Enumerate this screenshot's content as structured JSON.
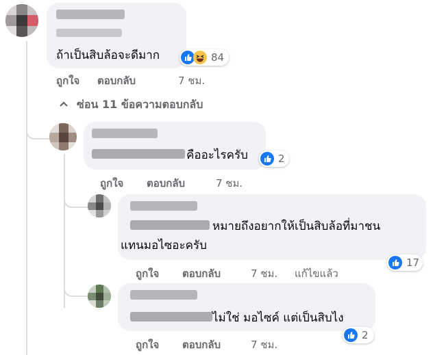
{
  "colors": {
    "bubble": "#f0f2f5",
    "meta_text": "#65676b",
    "like_blue": "#1877f2",
    "haha_yellow": "#f7c44b",
    "thread_line": "#dadde1"
  },
  "icons": {
    "like": "like-icon",
    "haha": "haha-icon",
    "chevron": "chevron-up-icon"
  },
  "comments": [
    {
      "text": "ถ้าเป็นสิบล้อจะดีมาก",
      "reactions": [
        "like",
        "haha"
      ],
      "reaction_count": "84",
      "like_label": "ถูกใจ",
      "reply_label": "ตอบกลับ",
      "time": "7 ชม."
    }
  ],
  "hide_replies_label": "ซ่อน 11 ข้อความตอบกลับ",
  "replies": [
    {
      "text": "คืออะไรครับ",
      "reactions": [
        "like"
      ],
      "reaction_count": "2",
      "like_label": "ถูกใจ",
      "reply_label": "ตอบกลับ",
      "time": "7 ชม."
    },
    {
      "text_line1": "หมายถึงอยากให้เป็นสิบล้อที่มาชน",
      "text_line2": "แทนมอไซอะครับ",
      "reactions": [
        "like"
      ],
      "reaction_count": "17",
      "like_label": "ถูกใจ",
      "reply_label": "ตอบกลับ",
      "time": "7 ชม.",
      "edited_label": "แก้ไขแล้ว"
    },
    {
      "text": "ไม่ใช่ มอไซค์ แต่เป็นสิบไง",
      "reactions": [
        "like"
      ],
      "reaction_count": "2",
      "like_label": "ถูกใจ",
      "reply_label": "ตอบกลับ",
      "time": "7 ชม."
    }
  ]
}
